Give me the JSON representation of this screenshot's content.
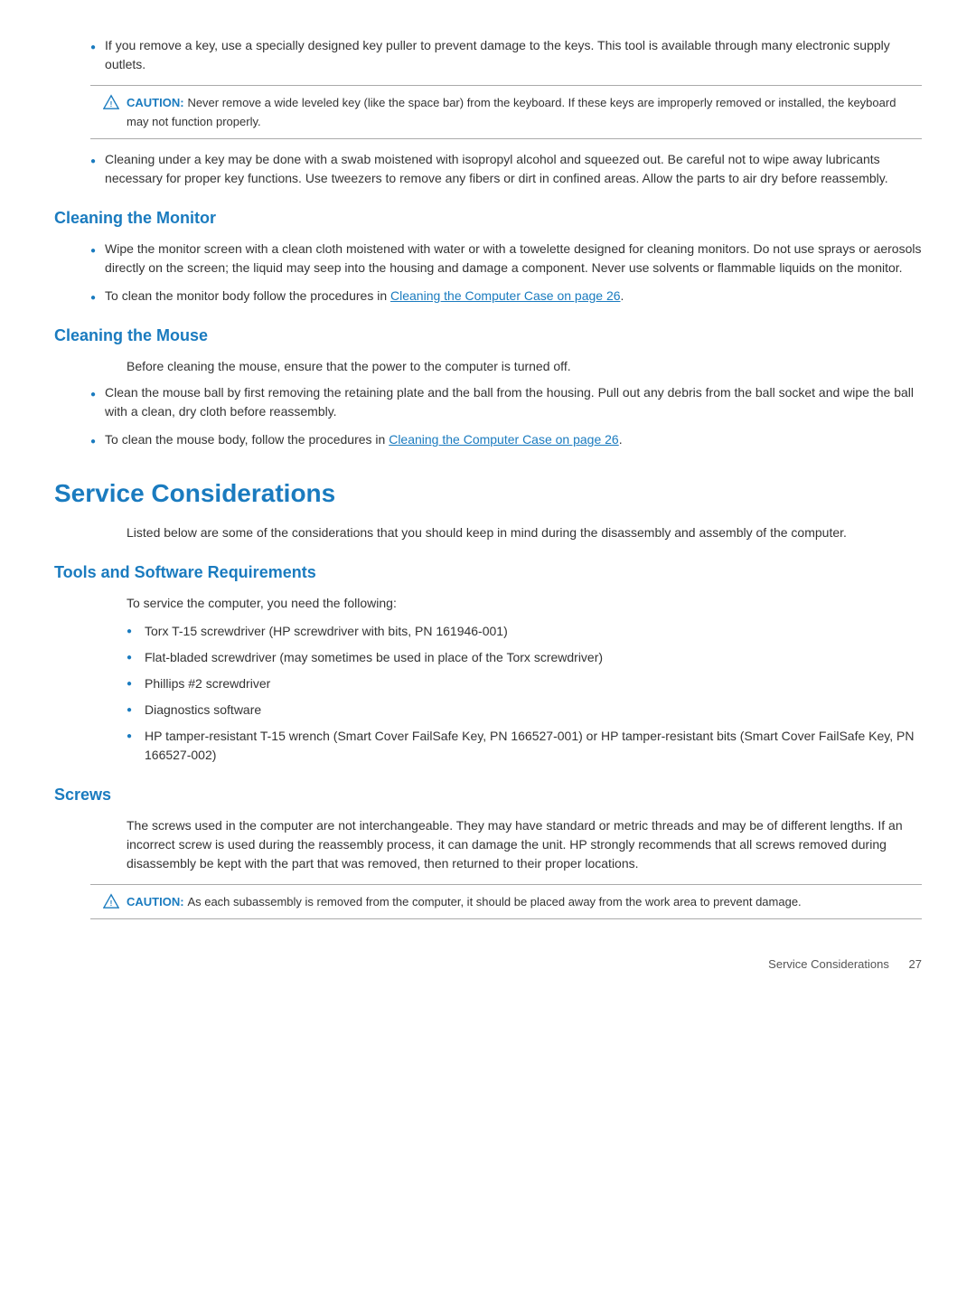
{
  "top_section": {
    "bullet_key_puller": "If you remove a key, use a specially designed key puller to prevent damage to the keys. This tool is available through many electronic supply outlets.",
    "caution_1": {
      "label": "CAUTION:",
      "text": "Never remove a wide leveled key (like the space bar) from the keyboard. If these keys are improperly removed or installed, the keyboard may not function properly."
    },
    "bullet_cleaning_key": "Cleaning under a key may be done with a swab moistened with isopropyl alcohol and squeezed out. Be careful not to wipe away lubricants necessary for proper key functions. Use tweezers to remove any fibers or dirt in confined areas. Allow the parts to air dry before reassembly."
  },
  "cleaning_monitor": {
    "heading": "Cleaning the Monitor",
    "bullet_1": "Wipe the monitor screen with a clean cloth moistened with water or with a towelette designed for cleaning monitors. Do not use sprays or aerosols directly on the screen; the liquid may seep into the housing and damage a component. Never use solvents or flammable liquids on the monitor.",
    "bullet_2_prefix": "To clean the monitor body follow the procedures in ",
    "bullet_2_link": "Cleaning the Computer Case on page 26",
    "bullet_2_suffix": "."
  },
  "cleaning_mouse": {
    "heading": "Cleaning the Mouse",
    "intro": "Before cleaning the mouse, ensure that the power to the computer is turned off.",
    "bullet_1": "Clean the mouse ball by first removing the retaining plate and the ball from the housing. Pull out any debris from the ball socket and wipe the ball with a clean, dry cloth before reassembly.",
    "bullet_2_prefix": "To clean the mouse body, follow the procedures in ",
    "bullet_2_link": "Cleaning the Computer Case on page 26",
    "bullet_2_suffix": "."
  },
  "service_considerations": {
    "heading": "Service Considerations",
    "intro": "Listed below are some of the considerations that you should keep in mind during the disassembly and assembly of the computer."
  },
  "tools_software": {
    "heading": "Tools and Software Requirements",
    "intro": "To service the computer, you need the following:",
    "bullets": [
      "Torx T-15 screwdriver (HP screwdriver with bits, PN 161946-001)",
      "Flat-bladed screwdriver (may sometimes be used in place of the Torx screwdriver)",
      "Phillips #2 screwdriver",
      "Diagnostics software",
      "HP tamper-resistant T-15 wrench (Smart Cover FailSafe Key, PN 166527-001) or HP tamper-resistant bits (Smart Cover FailSafe Key, PN 166527-002)"
    ]
  },
  "screws": {
    "heading": "Screws",
    "paragraph": "The screws used in the computer are not interchangeable. They may have standard or metric threads and may be of different lengths. If an incorrect screw is used during the reassembly process, it can damage the unit. HP strongly recommends that all screws removed during disassembly be kept with the part that was removed, then returned to their proper locations.",
    "caution": {
      "label": "CAUTION:",
      "text": "As each subassembly is removed from the computer, it should be placed away from the work area to prevent damage."
    }
  },
  "footer": {
    "left": "Service Considerations",
    "right": "27"
  },
  "icons": {
    "triangle_warning": "⚠"
  }
}
